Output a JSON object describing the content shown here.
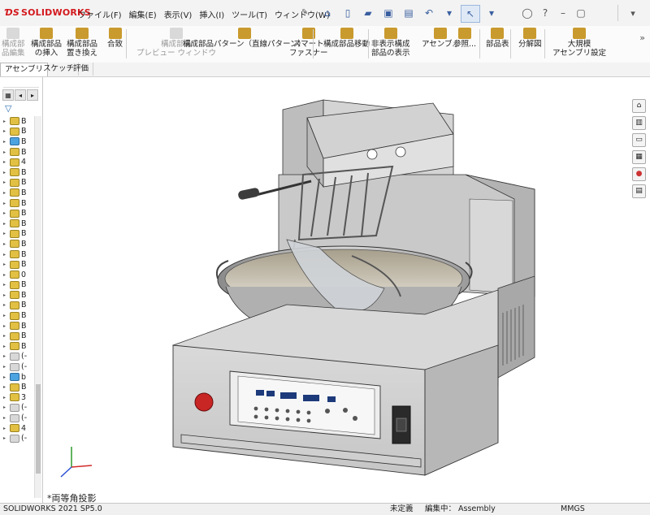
{
  "app": {
    "brand": "SOLIDWORKS"
  },
  "menu": [
    "ファイル(F)",
    "編集(E)",
    "表示(V)",
    "挿入(I)",
    "ツール(T)",
    "ウィンドウ(W)"
  ],
  "quick_access": [
    "home-icon",
    "new-document-icon",
    "open-icon",
    "save-icon",
    "print-icon",
    "undo-icon",
    "select-icon"
  ],
  "right_icons": [
    "help-circle-icon",
    "question-icon",
    "minimize-icon",
    "restore-icon"
  ],
  "ribbon": [
    {
      "label": "構成部\n品編集",
      "disabled": true
    },
    {
      "label": "構成部品\nの挿入",
      "disabled": false
    },
    {
      "label": "構成部品\n置き換え",
      "disabled": false
    },
    {
      "label": "合致",
      "disabled": false
    },
    {
      "label": "構成部品\nプレビュー ウィンドウ",
      "disabled": true
    },
    {
      "label": "構成部品パターン（直線パターン）",
      "disabled": false
    },
    {
      "label": "スマート\nファスナー",
      "disabled": false
    },
    {
      "label": "構成部品移動",
      "disabled": false
    },
    {
      "label": "非表示構成\n部品の表示",
      "disabled": false
    },
    {
      "label": "アセンブ...",
      "disabled": false
    },
    {
      "label": "参照...",
      "disabled": false
    },
    {
      "label": "部品表",
      "disabled": false
    },
    {
      "label": "分解図",
      "disabled": false
    },
    {
      "label": "大規模\nアセンブリ設定",
      "disabled": false
    }
  ],
  "tabs": [
    "アセンブリ",
    "スケッチ",
    "評価"
  ],
  "tree_items": [
    "B",
    "B",
    "B",
    "B",
    "4",
    "B",
    "B",
    "B",
    "B",
    "B",
    "B",
    "B",
    "B",
    "B",
    "B",
    "0",
    "B",
    "B",
    "B",
    "B",
    "B",
    "B",
    "B",
    "(-",
    "(-",
    "b",
    "B",
    "3",
    "(-",
    "(-",
    "4",
    "(-"
  ],
  "view": {
    "label": "*両等角投影"
  },
  "status": {
    "version": "SOLIDWORKS 2021 SP5.0",
    "state": "未定義",
    "editing": "編集中： Assembly",
    "units": "MMGS"
  }
}
